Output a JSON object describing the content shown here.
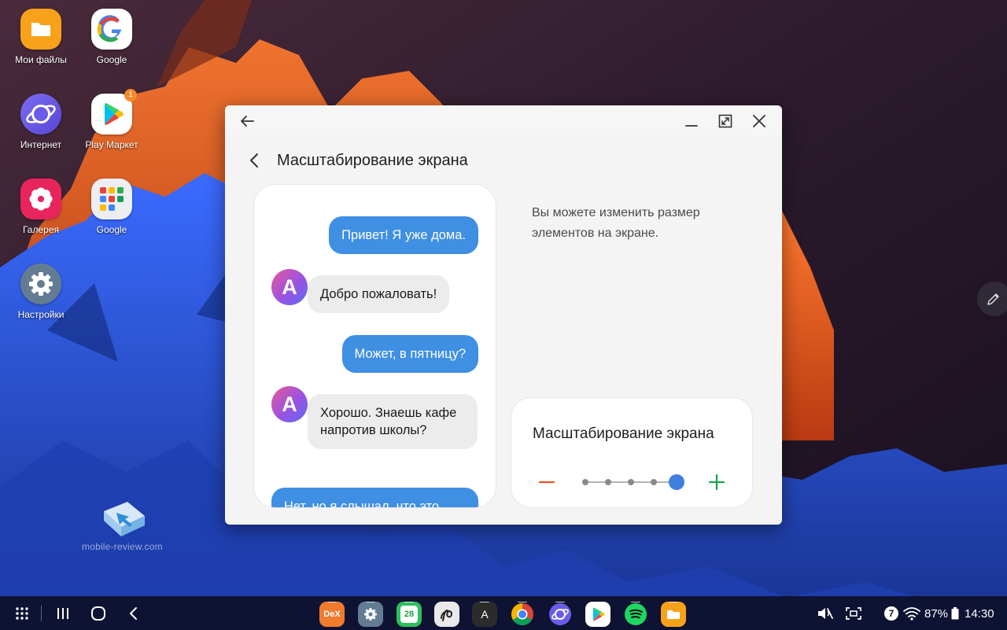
{
  "desktop": {
    "icons": [
      {
        "label": "Мои файлы"
      },
      {
        "label": "Google"
      },
      {
        "label": "Интернет"
      },
      {
        "label": "Play Маркет",
        "badge": "1"
      },
      {
        "label": "Галерея"
      },
      {
        "label": "Google"
      },
      {
        "label": "Настройки"
      }
    ]
  },
  "window": {
    "page_title": "Масштабирование экрана",
    "preview_messages": [
      {
        "direction": "out",
        "text": "Привет! Я уже дома."
      },
      {
        "direction": "in",
        "avatar": "A",
        "text": "Добро пожаловать!"
      },
      {
        "direction": "out",
        "text": "Может, в пятницу?"
      },
      {
        "direction": "in",
        "avatar": "A",
        "text": "Хорошо. Знаешь кафе напротив школы?"
      },
      {
        "direction": "out",
        "text": "Нет, но я слышал, что это"
      }
    ],
    "description": "Вы можете изменить размер элементов на экране.",
    "scale_card": {
      "title": "Масштабирование экрана",
      "level": 5,
      "levels": 5
    }
  },
  "watermark": {
    "text": "mobile-review.com"
  },
  "taskbar": {
    "dock_apps": [
      {
        "icon": "dex-icon",
        "label": "DeX"
      },
      {
        "icon": "settings-icon"
      },
      {
        "icon": "calendar-icon",
        "label": "28"
      },
      {
        "icon": "pen-up-icon"
      },
      {
        "icon": "font-app-icon",
        "label": "A"
      },
      {
        "icon": "chrome-icon"
      },
      {
        "icon": "samsung-internet-icon"
      },
      {
        "icon": "play-store-icon"
      },
      {
        "icon": "spotify-icon"
      },
      {
        "icon": "my-files-icon"
      }
    ],
    "notification_count": "7",
    "battery": "87%",
    "clock": "14:30"
  },
  "colors": {
    "accent": "#3f8fe3",
    "minus": "#e5532d",
    "plus": "#17a34a",
    "slider_thumb": "#3f7fe0"
  }
}
